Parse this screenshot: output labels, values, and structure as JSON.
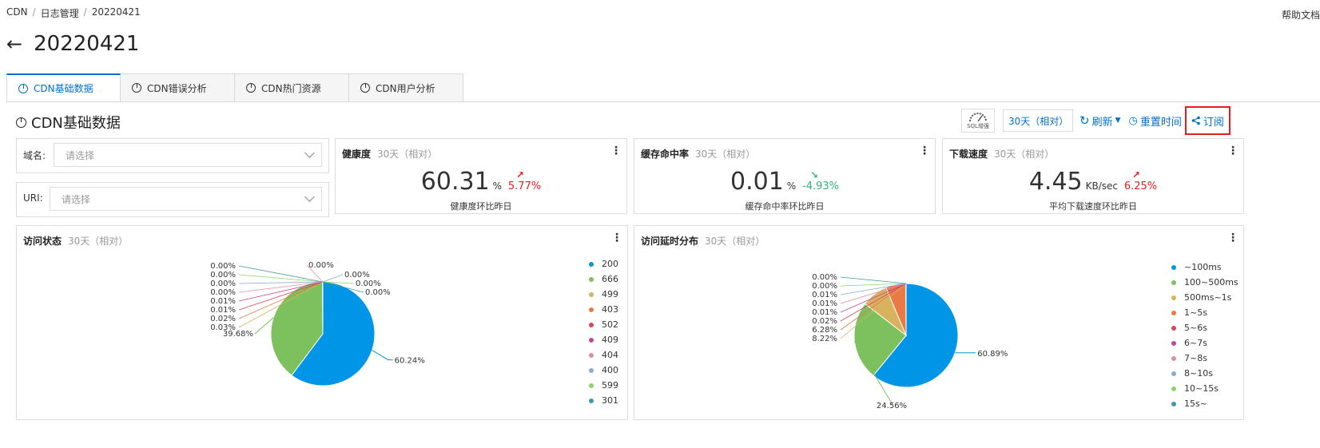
{
  "breadcrumb": [
    "CDN",
    "日志管理",
    "20220421"
  ],
  "help_link": "帮助文档",
  "page": {
    "back_glyph": "←",
    "title": "20220421"
  },
  "tabs": [
    "CDN基础数据",
    "CDN错误分析",
    "CDN热门资源",
    "CDN用户分析"
  ],
  "section": {
    "title": "CDN基础数据"
  },
  "toolbar": {
    "sql_label": "SQL增强",
    "range": "30天（相对）",
    "refresh": "刷新",
    "reset_time": "重置时间",
    "subscribe": "订阅"
  },
  "filters": {
    "domain": {
      "label": "域名:",
      "placeholder": "请选择"
    },
    "uri": {
      "label": "URI:",
      "placeholder": "请选择"
    }
  },
  "metrics": [
    {
      "title": "健康度",
      "range": "30天（相对）",
      "value": "60.31",
      "unit": "%",
      "change": "5.77%",
      "trend": "up",
      "arrow": "↗",
      "caption": "健康度环比昨日"
    },
    {
      "title": "缓存命中率",
      "range": "30天（相对）",
      "value": "0.01",
      "unit": "%",
      "change": "-4.93%",
      "trend": "down",
      "arrow": "↘",
      "caption": "缓存命中率环比昨日"
    },
    {
      "title": "下载速度",
      "range": "30天（相对）",
      "value": "4.45",
      "unit": "KB/sec",
      "change": "6.25%",
      "trend": "up",
      "arrow": "↗",
      "caption": "平均下载速度环比昨日"
    }
  ],
  "kebab": "⋮",
  "pie_cards": [
    {
      "title": "访问状态",
      "range": "30天（相对）"
    },
    {
      "title": "访问延时分布",
      "range": "30天（相对）"
    }
  ],
  "chart_data": [
    {
      "type": "pie",
      "title": "访问状态",
      "categories": [
        "200",
        "666",
        "499",
        "403",
        "502",
        "409",
        "404",
        "400",
        "599",
        "301"
      ],
      "values": [
        60.24,
        39.68,
        0.03,
        0.02,
        0.01,
        0.01,
        0.0,
        0.0,
        0.0,
        0.0
      ],
      "labels": [
        "60.24%",
        "39.68%",
        "0.03%",
        "0.02%",
        "0.01%",
        "0.01%",
        "0.00%",
        "0.00%",
        "0.00%",
        "0.00%"
      ],
      "extra_labels": [
        "0.00%",
        "0.00%",
        "0.00%",
        "0.00%"
      ],
      "colors": [
        "#0095e6",
        "#7cc15e",
        "#d9b25f",
        "#e87a45",
        "#d8455c",
        "#c3479e",
        "#e48b9f",
        "#8aa9d3",
        "#8cd36e",
        "#4497a6"
      ],
      "legend_position": "right"
    },
    {
      "type": "pie",
      "title": "访问延时分布",
      "categories": [
        "~100ms",
        "100~500ms",
        "500ms~1s",
        "1~5s",
        "5~6s",
        "6~7s",
        "7~8s",
        "8~10s",
        "10~15s",
        "15s~"
      ],
      "values": [
        60.89,
        24.56,
        8.22,
        6.28,
        0.02,
        0.01,
        0.01,
        0.01,
        0.0,
        0.0
      ],
      "labels": [
        "60.89%",
        "24.56%",
        "8.22%",
        "6.28%",
        "0.02%",
        "0.01%",
        "0.01%",
        "0.01%",
        "0.00%",
        "0.00%"
      ],
      "colors": [
        "#0095e6",
        "#7cc15e",
        "#d9b25f",
        "#e87a45",
        "#d8455c",
        "#c3479e",
        "#e48b9f",
        "#8aa9d3",
        "#8cd36e",
        "#4497a6"
      ],
      "legend_position": "right"
    }
  ]
}
